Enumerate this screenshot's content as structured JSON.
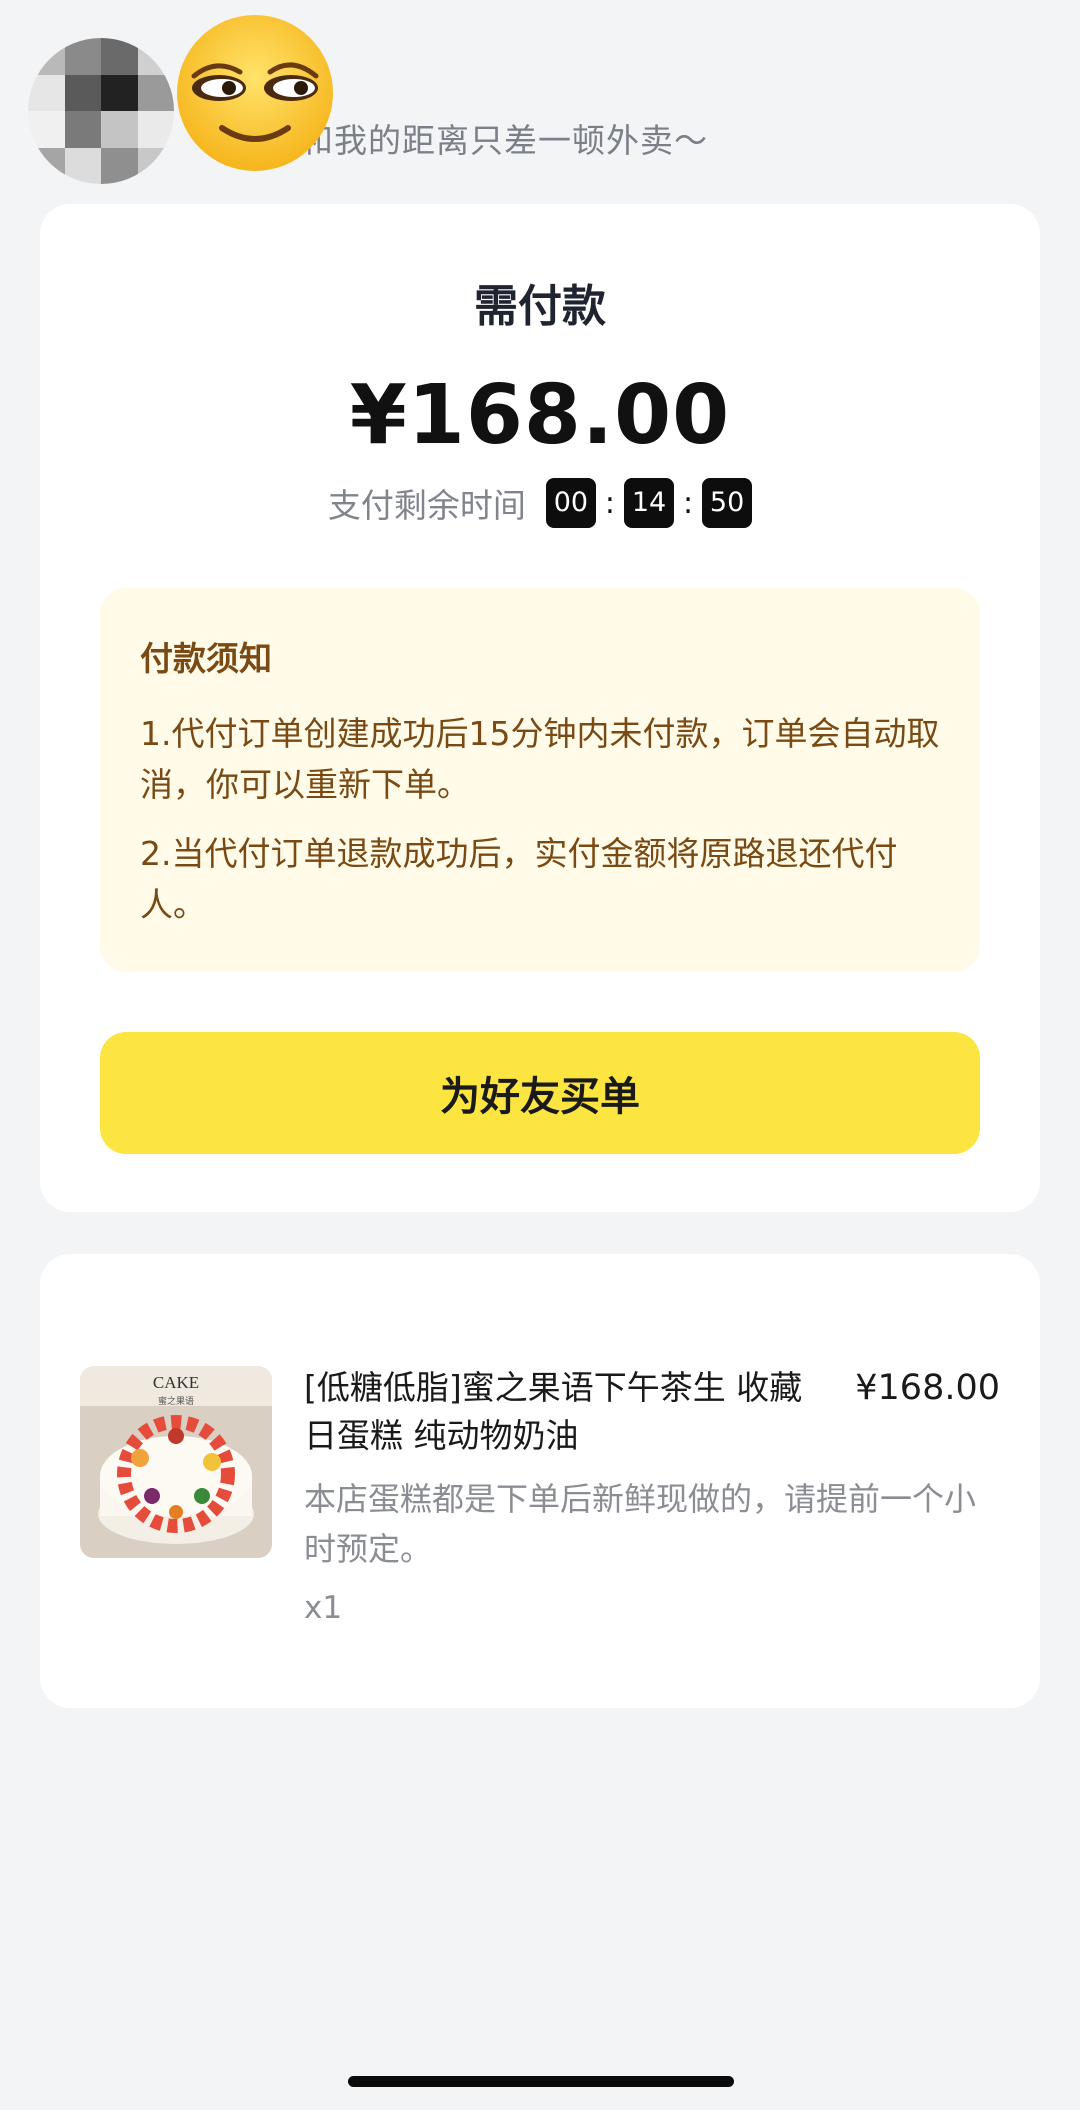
{
  "header": {
    "text": "和我的距离只差一顿外卖～",
    "avatar_icon": "blurred-avatar",
    "emoji_icon": "smug-face-emoji"
  },
  "payment": {
    "title": "需付款",
    "amount": "¥168.00",
    "timer_label": "支付剩余时间",
    "timer": {
      "hours": "00",
      "minutes": "14",
      "seconds": "50",
      "separator": ":"
    }
  },
  "notice": {
    "title": "付款须知",
    "items": [
      "1.代付订单创建成功后15分钟内未付款，订单会自动取消，你可以重新下单。",
      "2.当代付订单退款成功后，实付金额将原路退还代付人。"
    ],
    "background": "#fffbe8",
    "text_color": "#7a4a14"
  },
  "button": {
    "label": "为好友买单",
    "color": "#fce441"
  },
  "order": {
    "image_text": "CAKE",
    "image_subtext": "蜜之果语",
    "name": "[低糖低脂]蜜之果语下午茶生 收藏日蛋糕 纯动物奶油",
    "price": "¥168.00",
    "description": "本店蛋糕都是下单后新鲜现做的，请提前一个小时预定。",
    "quantity": "x1"
  }
}
